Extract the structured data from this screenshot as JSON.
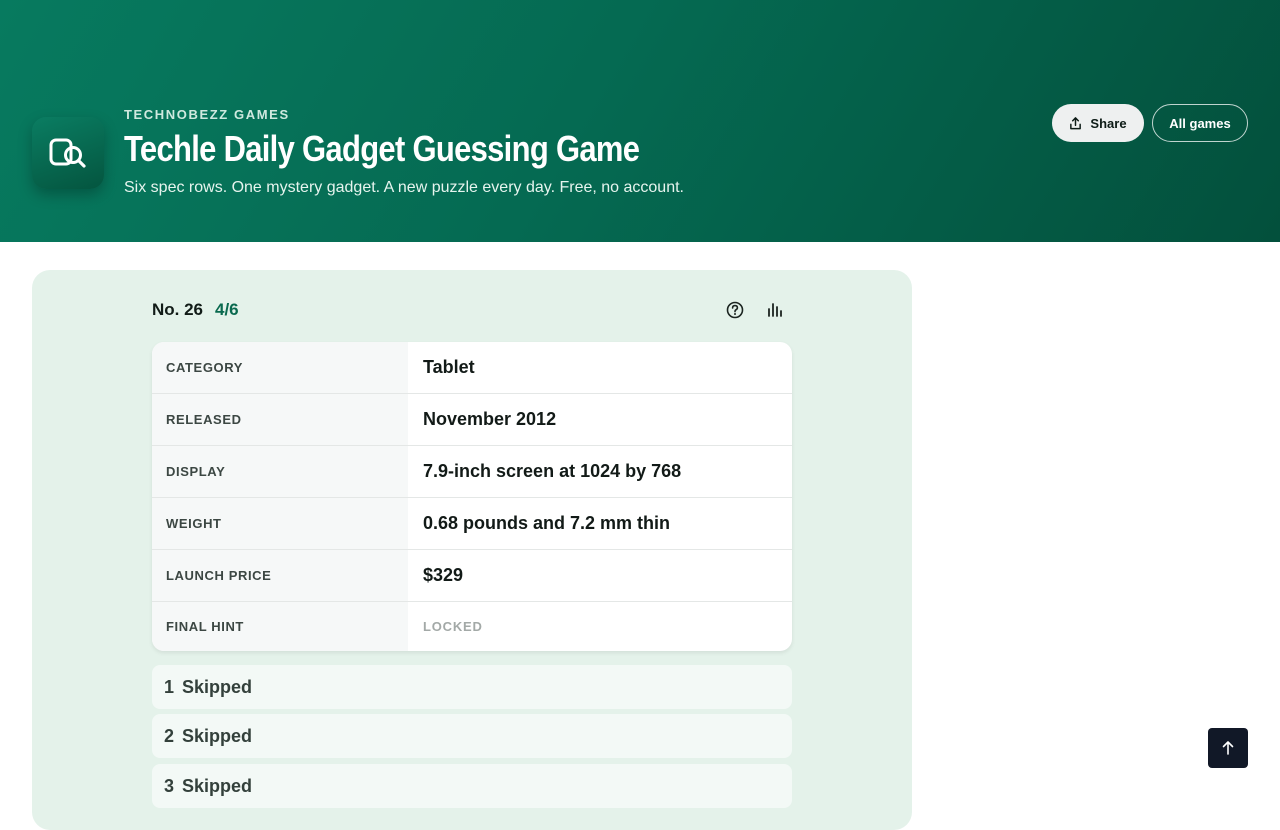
{
  "header": {
    "kicker": "TECHNOBEZZ GAMES",
    "title": "Techle Daily Gadget Guessing Game",
    "subtitle": "Six spec rows. One mystery gadget. A new puzzle every day. Free, no account.",
    "share_label": "Share",
    "all_games_label": "All games",
    "logo_icon": "search-gadget-icon"
  },
  "puzzle": {
    "number_label": "No. 26",
    "attempts": "4/6",
    "help_icon": "help-circle-icon",
    "stats_icon": "bar-chart-icon"
  },
  "specs": [
    {
      "key": "CATEGORY",
      "value": "Tablet"
    },
    {
      "key": "RELEASED",
      "value": "November 2012"
    },
    {
      "key": "DISPLAY",
      "value": "7.9-inch screen at 1024 by 768"
    },
    {
      "key": "WEIGHT",
      "value": "0.68 pounds and 7.2 mm thin"
    },
    {
      "key": "LAUNCH PRICE",
      "value": "$329"
    },
    {
      "key": "FINAL HINT",
      "value": "LOCKED"
    }
  ],
  "guesses": [
    {
      "num": "1",
      "label": "Skipped"
    },
    {
      "num": "2",
      "label": "Skipped"
    },
    {
      "num": "3",
      "label": "Skipped"
    }
  ],
  "colors": {
    "header_start": "#077a5f",
    "header_end": "#03503c",
    "accent": "#0a6a4f",
    "panel_bg": "#e4f2ea"
  }
}
